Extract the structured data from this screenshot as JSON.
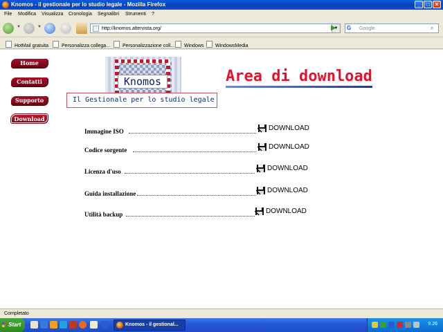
{
  "window": {
    "title": "Knomos - il gestionale per lo studio legale - Mozilla Firefox",
    "minimize": "_",
    "maximize": "□",
    "close": "×"
  },
  "menu": [
    "File",
    "Modifica",
    "Visualizza",
    "Cronologia",
    "Segnalibri",
    "Strumenti",
    "?"
  ],
  "navbar": {
    "url": "http://knomos.altervista.org/",
    "search_placeholder": "Google"
  },
  "bookmarks": [
    "HotMail gratuita",
    "Personalizza collega...",
    "Personalizzazione coll...",
    "Windows",
    "WindowsMedia"
  ],
  "site": {
    "nav": [
      "Home",
      "Contatti",
      "Supporto",
      "Download"
    ],
    "logo_text": "Knomos",
    "tagline": "Il Gestionale per lo studio legale",
    "heading": "Area di download",
    "downloads": [
      {
        "label": "Immagine ISO",
        "link": "DOWNLOAD"
      },
      {
        "label": "Codice sorgente",
        "link": "DOWNLOAD"
      },
      {
        "label": "Licenza d'uso",
        "link": "DOWNLOAD"
      },
      {
        "label": "Guida installazione",
        "link": "DOWNLOAD"
      },
      {
        "label": "Utilità backup",
        "link": "DOWNLOAD"
      }
    ],
    "colors": {
      "nav_button": "#8a0a1e",
      "heading": "#e8112d",
      "tagline": "#0a2a6a"
    }
  },
  "status": "Completato",
  "taskbar": {
    "start": "Start",
    "active_window": "Knomos - il gestional...",
    "clock": "9.26"
  }
}
